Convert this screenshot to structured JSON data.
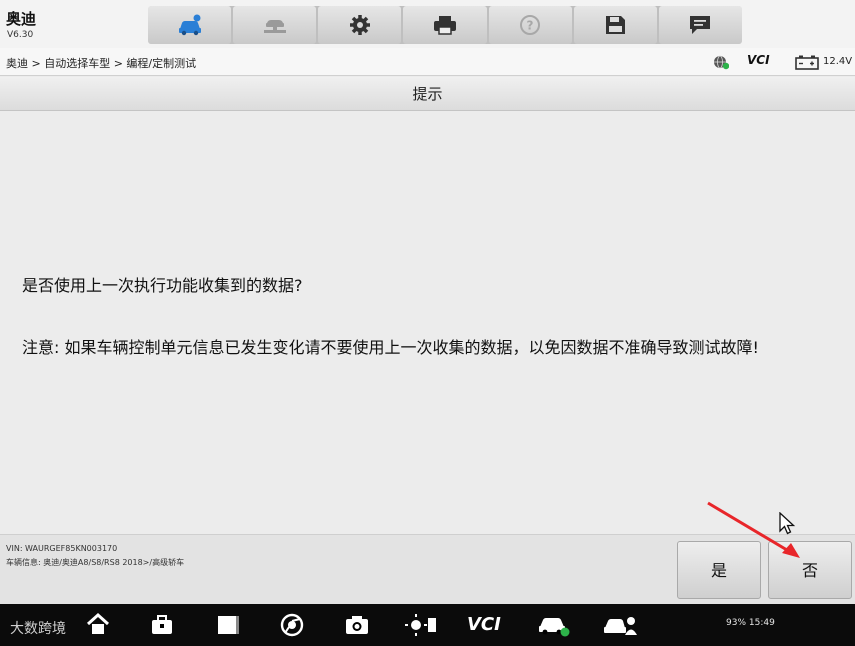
{
  "app": {
    "title": "奥迪",
    "version": "V6.30"
  },
  "toolbar": {
    "buttons": [
      {
        "icon": "car-diagnostics-icon",
        "active": true
      },
      {
        "icon": "vehicle-lift-icon",
        "disabled": true
      },
      {
        "icon": "gear-icon"
      },
      {
        "icon": "printer-icon"
      },
      {
        "icon": "help-icon",
        "disabled": true
      },
      {
        "icon": "save-icon"
      },
      {
        "icon": "message-icon"
      }
    ]
  },
  "breadcrumb": "奥迪 > 自动选择车型 > 编程/定制测试",
  "status": {
    "network_icon": "globe-icon",
    "vci": "VCI",
    "battery_icon": "battery-icon",
    "voltage": "12.4V"
  },
  "dialog": {
    "title": "提示",
    "question": "是否使用上一次执行功能收集到的数据?",
    "notice": "注意: 如果车辆控制单元信息已发生变化请不要使用上一次收集的数据，以免因数据不准确导致测试故障!"
  },
  "info": {
    "vin": "VIN: WAURGEF85KN003170",
    "vehicle": "车辆信息: 奥迪/奥迪A8/S8/RS8 2018>/高级轿车"
  },
  "buttons": {
    "yes": "是",
    "no": "否"
  },
  "navbar": {
    "watermark": "大数跨境",
    "vci_label": "VCI",
    "system_status": "93% 15:49",
    "icons": [
      "back-icon",
      "home-icon",
      "toolbox-icon",
      "recent-apps-icon",
      "chrome-icon",
      "camera-icon",
      "brightness-icon",
      "vci-icon",
      "car-check-icon",
      "remote-icon"
    ]
  },
  "colors": {
    "accent_blue": "#2a7fd6",
    "annotation_red": "#e8262a"
  }
}
